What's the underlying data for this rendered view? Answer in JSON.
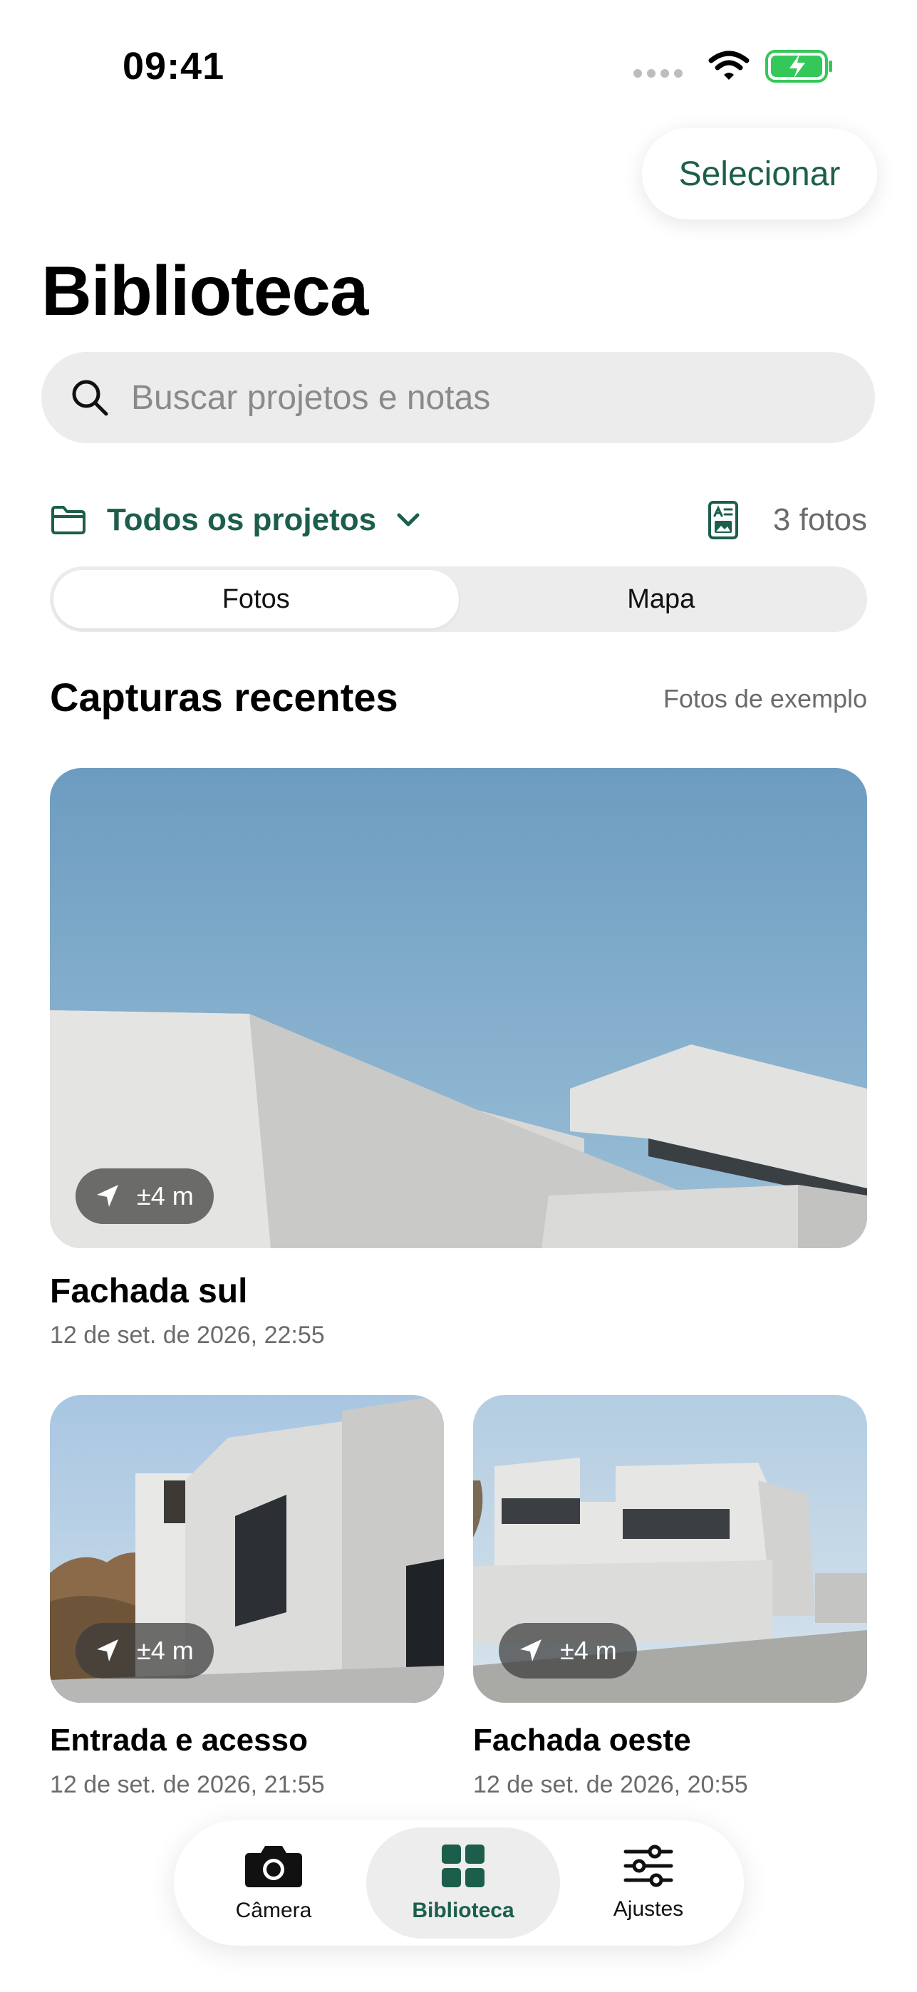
{
  "status_bar": {
    "time": "09:41"
  },
  "header": {
    "select_label": "Selecionar",
    "title": "Biblioteca"
  },
  "search": {
    "placeholder": "Buscar projetos e notas"
  },
  "filter": {
    "project_label": "Todos os projetos",
    "photo_count": "3 fotos"
  },
  "segments": [
    {
      "label": "Fotos",
      "selected": true
    },
    {
      "label": "Mapa",
      "selected": false
    }
  ],
  "section": {
    "title": "Capturas recentes",
    "link": "Fotos de exemplo"
  },
  "photos": [
    {
      "title": "Fachada sul",
      "date": "12 de set. de 2026, 22:55",
      "accuracy": "±4 m"
    },
    {
      "title": "Entrada e acesso",
      "date": "12 de set. de 2026, 21:55",
      "accuracy": "±4 m"
    },
    {
      "title": "Fachada oeste",
      "date": "12 de set. de 2026, 20:55",
      "accuracy": "±4 m"
    }
  ],
  "tabbar": {
    "items": [
      {
        "label": "Câmera",
        "icon": "camera-icon",
        "active": false
      },
      {
        "label": "Biblioteca",
        "icon": "grid-icon",
        "active": true
      },
      {
        "label": "Ajustes",
        "icon": "sliders-icon",
        "active": false
      }
    ]
  },
  "colors": {
    "accent": "#1c5e4c",
    "battery": "#34c759",
    "surface": "#ececec"
  }
}
